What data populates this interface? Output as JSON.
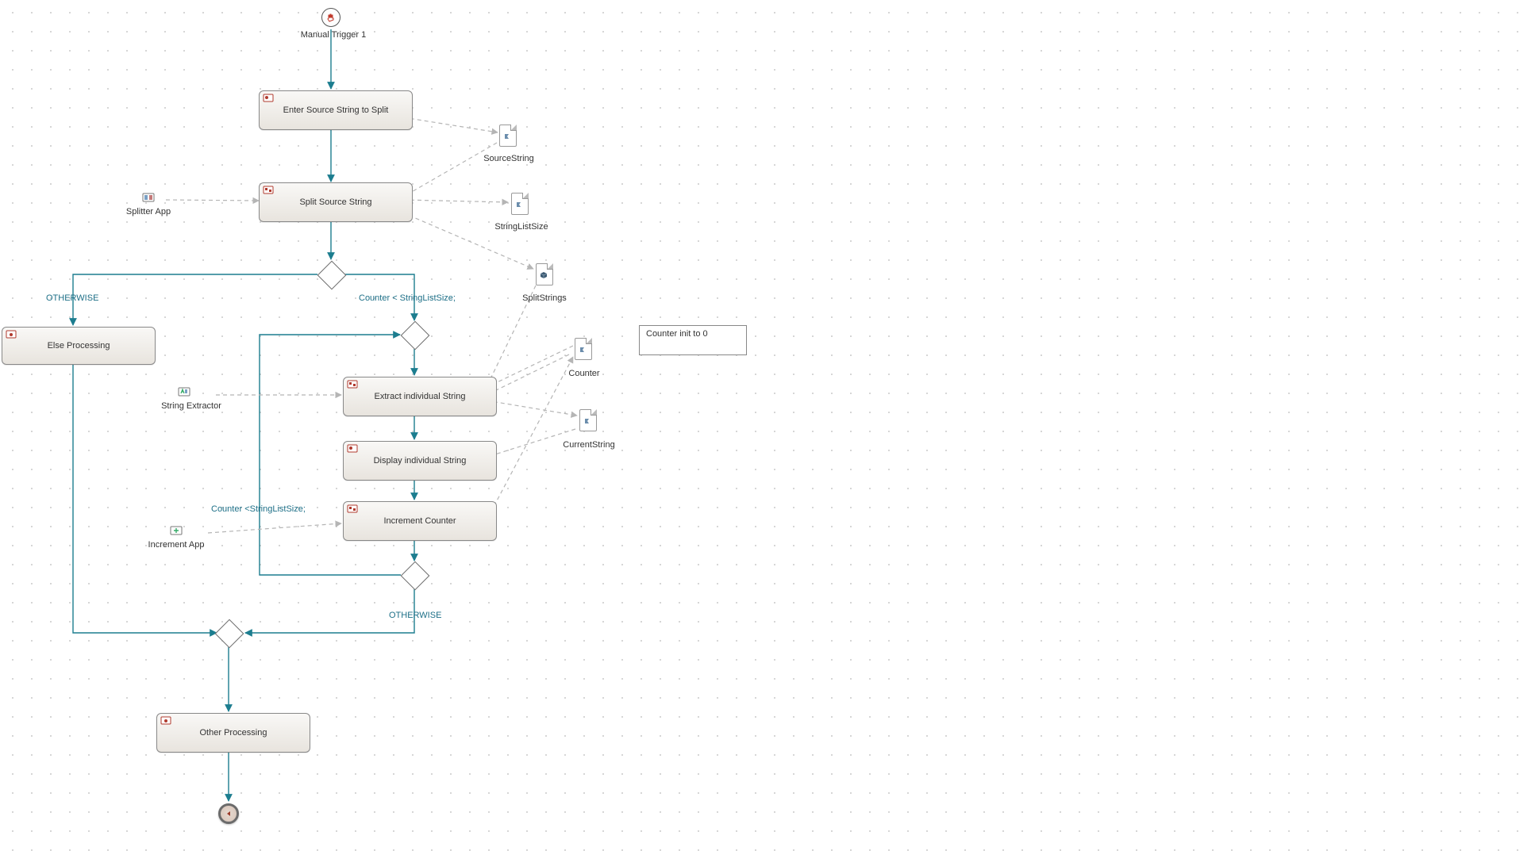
{
  "trigger": {
    "label": "Manual Trigger 1"
  },
  "tasks": {
    "enter_source": "Enter Source String to Split",
    "split_source": "Split Source String",
    "else_proc": "Else Processing",
    "extract_ind": "Extract individual String",
    "display_ind": "Display individual String",
    "inc_counter": "Increment Counter",
    "other_proc": "Other Processing"
  },
  "data_objects": {
    "source_string": "SourceString",
    "string_list_size": "StringListSize",
    "split_strings": "SplitStrings",
    "counter": "Counter",
    "current_string": "CurrentString"
  },
  "apps": {
    "splitter": "Splitter App",
    "extractor": "String Extractor",
    "increment": "Increment App"
  },
  "conditions": {
    "otherwise": "OTHERWISE",
    "counter_lt_size": "Counter < StringListSize;",
    "counter_lt_size_2": "Counter <StringListSize;"
  },
  "note": {
    "counter_init": "Counter init to 0"
  }
}
